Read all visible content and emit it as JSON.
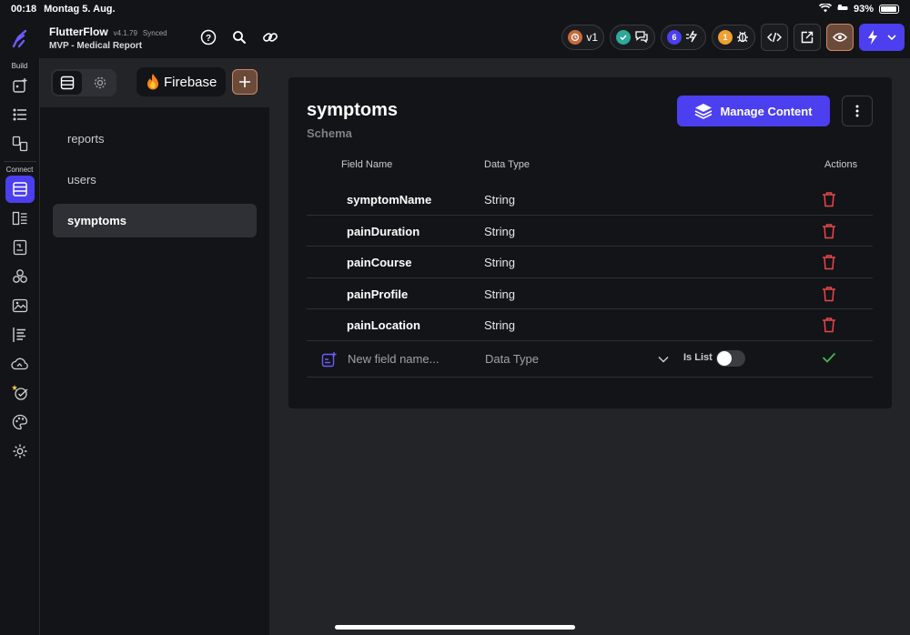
{
  "status": {
    "time": "00:18",
    "date": "Montag 5. Aug.",
    "battery": "93%",
    "battery_level": 0.93
  },
  "app": {
    "name": "FlutterFlow",
    "version": "v4.1.79",
    "sync": "Synced",
    "project": "MVP - Medical Report"
  },
  "toolbar": {
    "version_badge": "v1",
    "issues_count": "6",
    "warnings_count": "1"
  },
  "rail": {
    "build_label": "Build",
    "connect_label": "Connect"
  },
  "panel": {
    "firebase_label": "Firebase",
    "collections": [
      "reports",
      "users",
      "symptoms"
    ],
    "selected": "symptoms"
  },
  "schema": {
    "title": "symptoms",
    "subtitle": "Schema",
    "manage_label": "Manage Content",
    "columns": {
      "field": "Field Name",
      "type": "Data Type",
      "actions": "Actions"
    },
    "fields": [
      {
        "name": "symptomName",
        "type": "String"
      },
      {
        "name": "painDuration",
        "type": "String"
      },
      {
        "name": "painCourse",
        "type": "String"
      },
      {
        "name": "painProfile",
        "type": "String"
      },
      {
        "name": "painLocation",
        "type": "String"
      }
    ],
    "new_field": {
      "placeholder": "New field name...",
      "data_type": "Data Type",
      "is_list_label": "Is List",
      "is_list": false
    }
  },
  "colors": {
    "accent": "#4b3ff0",
    "delete": "#e5484d",
    "confirm": "#3fb950"
  }
}
